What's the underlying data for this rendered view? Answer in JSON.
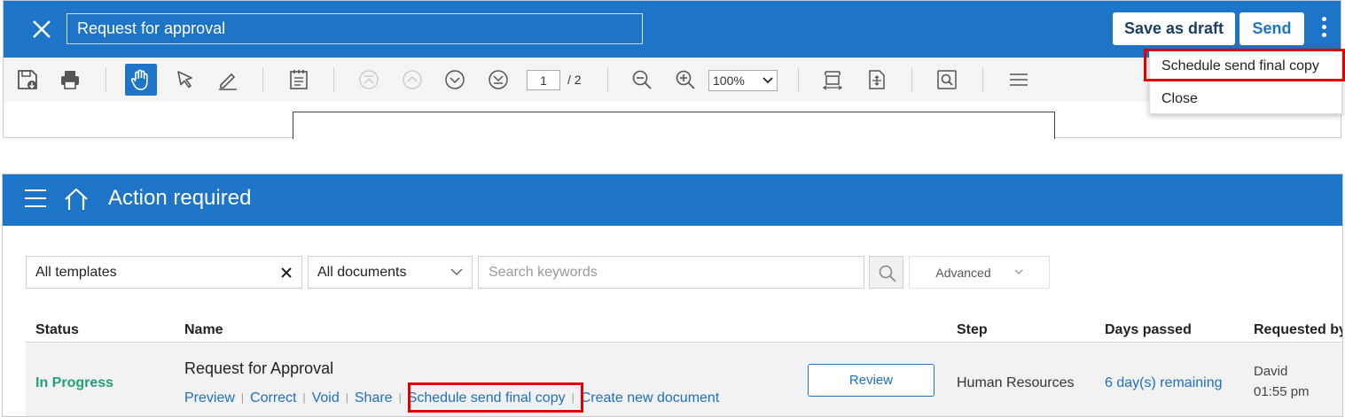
{
  "editor": {
    "title_value": "Request for approval",
    "save_draft_label": "Save as draft",
    "send_label": "Send",
    "page_current": "1",
    "page_total": "/ 2",
    "zoom_value": "100%",
    "menu_items": [
      "Schedule send final copy",
      "Close"
    ]
  },
  "inbox": {
    "heading": "Action required",
    "templates_filter": "All templates",
    "documents_filter": "All documents",
    "search_placeholder": "Search keywords",
    "advanced_label": "Advanced",
    "columns": [
      "Status",
      "Name",
      "Step",
      "Days passed",
      "Requested by"
    ],
    "row": {
      "status": "In Progress",
      "name": "Request for Approval",
      "actions": [
        "Preview",
        "Correct",
        "Void",
        "Share",
        "Schedule send final copy",
        "Create new document"
      ],
      "review_label": "Review",
      "step": "Human Resources",
      "days": "6 day(s) remaining",
      "requested_by_name": "David",
      "requested_by_time": "01:55 pm"
    }
  },
  "colors": {
    "brand_blue": "#1e74c6",
    "status_green": "#1fa07a",
    "highlight_red": "#e00000"
  }
}
